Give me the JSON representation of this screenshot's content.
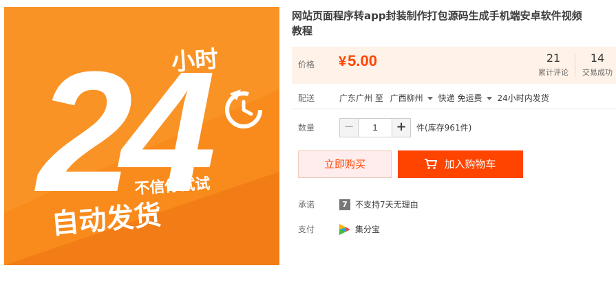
{
  "image": {
    "hours": "24",
    "unit": "小时",
    "tagline": "不信你试试",
    "headline": "自动发货",
    "colors": {
      "bg": "#f98a1c",
      "bg_dark": "#f07612",
      "text": "#ffffff"
    },
    "icon": "clock-arrow-icon"
  },
  "product": {
    "title_line1": "网站页面程序转app封装制作打包源码生成手机端安卓软件视频",
    "title_line2": "教程"
  },
  "price": {
    "label": "价格",
    "currency": "¥",
    "value": "5.00",
    "reviews_count": "21",
    "reviews_label": "累计评论",
    "trades_count": "14",
    "trades_label": "交易成功"
  },
  "shipping": {
    "label": "配送",
    "route": "广东广州 至",
    "destination": "广西柳州",
    "method": "快递 免运费",
    "time": "24小时内发货"
  },
  "quantity": {
    "label": "数量",
    "value": "1",
    "minus": "−",
    "plus": "+",
    "stock": "件(库存961件)"
  },
  "actions": {
    "buy_now": "立即购买",
    "add_to_cart": "加入购物车"
  },
  "promise": {
    "label": "承诺",
    "badge": "7",
    "text": "不支持7天无理由"
  },
  "payment": {
    "label": "支付",
    "method": "集分宝",
    "icon": "jifenbao-icon"
  }
}
